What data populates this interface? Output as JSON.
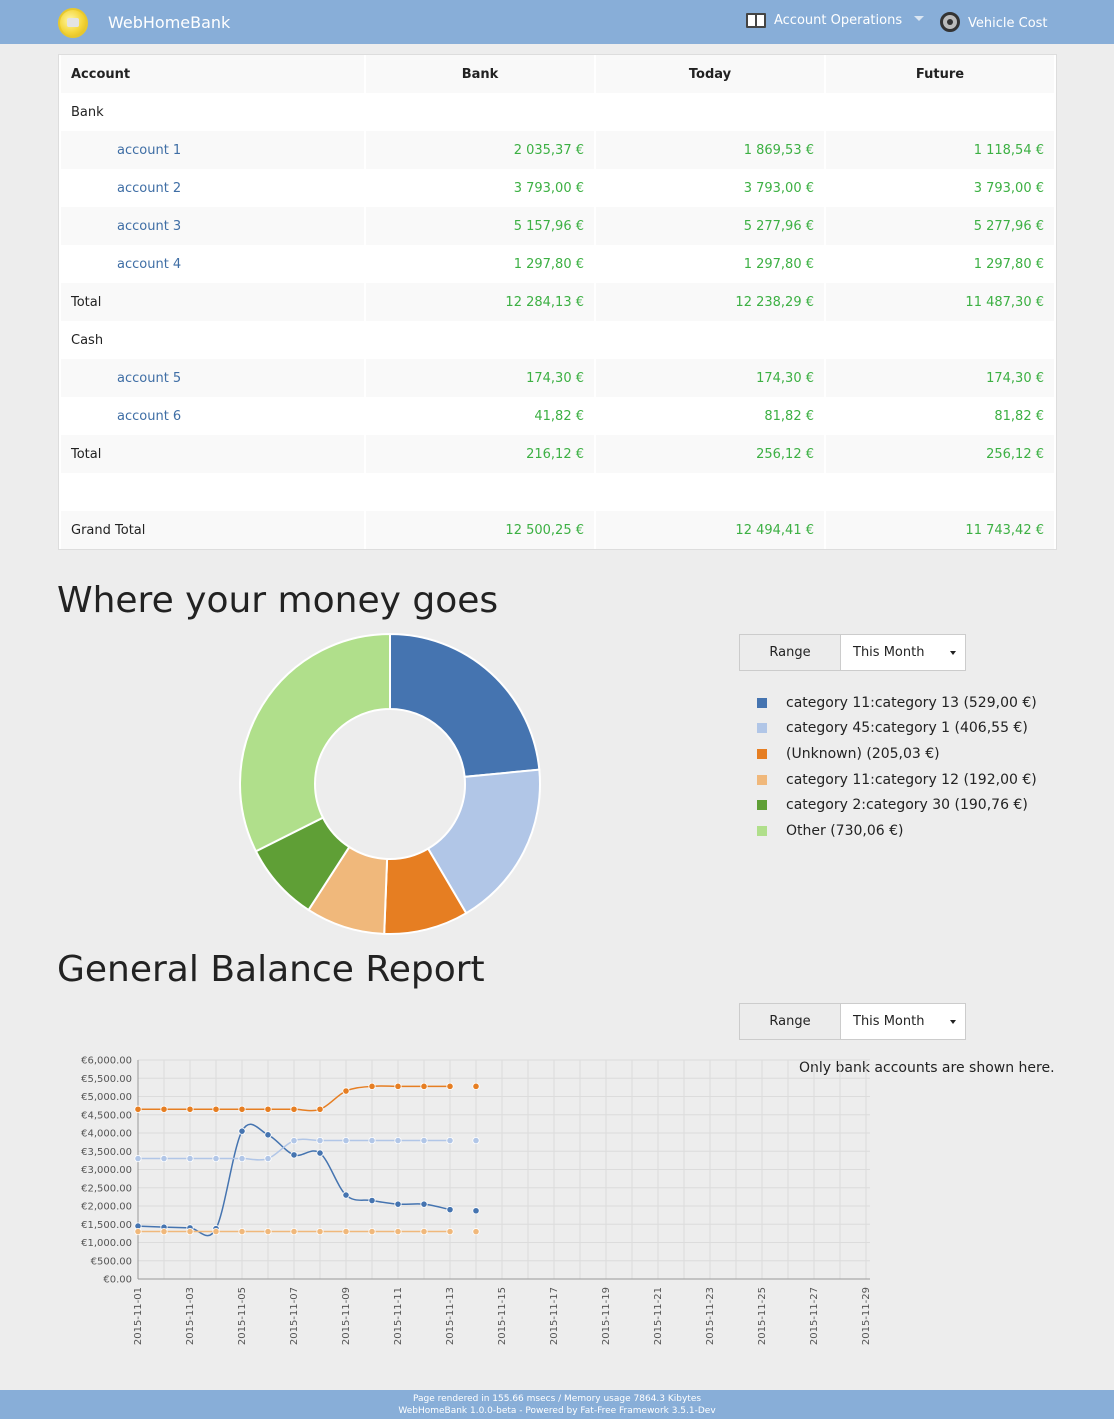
{
  "navbar": {
    "brand": "WebHomeBank",
    "items": [
      {
        "label": "Account Operations",
        "icon": "book-icon"
      },
      {
        "label": "Vehicle Cost",
        "icon": "steering-wheel-icon"
      }
    ]
  },
  "accounts_table": {
    "headers": [
      "Account",
      "Bank",
      "Today",
      "Future"
    ],
    "groups": [
      {
        "name": "Bank",
        "accounts": [
          {
            "name": "account 1",
            "bank": "2 035,37 €",
            "today": "1 869,53 €",
            "future": "1 118,54 €"
          },
          {
            "name": "account 2",
            "bank": "3 793,00 €",
            "today": "3 793,00 €",
            "future": "3 793,00 €"
          },
          {
            "name": "account 3",
            "bank": "5 157,96 €",
            "today": "5 277,96 €",
            "future": "5 277,96 €"
          },
          {
            "name": "account 4",
            "bank": "1 297,80 €",
            "today": "1 297,80 €",
            "future": "1 297,80 €"
          }
        ],
        "total": {
          "label": "Total",
          "bank": "12 284,13 €",
          "today": "12 238,29 €",
          "future": "11 487,30 €"
        }
      },
      {
        "name": "Cash",
        "accounts": [
          {
            "name": "account 5",
            "bank": "174,30 €",
            "today": "174,30 €",
            "future": "174,30 €"
          },
          {
            "name": "account 6",
            "bank": "41,82 €",
            "today": "81,82 €",
            "future": "81,82 €"
          }
        ],
        "total": {
          "label": "Total",
          "bank": "216,12 €",
          "today": "256,12 €",
          "future": "256,12 €"
        }
      }
    ],
    "grand_total": {
      "label": "Grand Total",
      "bank": "12 500,25 €",
      "today": "12 494,41 €",
      "future": "11 743,42 €"
    }
  },
  "money_section": {
    "title": "Where your money goes",
    "range_label": "Range",
    "range_value": "This Month"
  },
  "balance_section": {
    "title": "General Balance Report",
    "range_label": "Range",
    "range_value": "This Month",
    "note": "Only bank accounts are shown here."
  },
  "footer": {
    "line1": "Page rendered in 155.66 msecs / Memory usage 7864.3 Kibytes",
    "line2": "WebHomeBank 1.0.0-beta - Powered by Fat-Free Framework 3.5.1-Dev"
  },
  "chart_data": [
    {
      "type": "pie",
      "donut": true,
      "legend_position": "right",
      "slices": [
        {
          "label": "category 11:category 13 (529,00 €)",
          "value": 529.0,
          "color": "#4574b0"
        },
        {
          "label": "category 45:category 1 (406,55 €)",
          "value": 406.55,
          "color": "#b1c6e7"
        },
        {
          "label": "(Unknown) (205,03 €)",
          "value": 205.03,
          "color": "#e67e22"
        },
        {
          "label": "category 11:category 12 (192,00 €)",
          "value": 192.0,
          "color": "#f0b87b"
        },
        {
          "label": "category 2:category 30 (190,76 €)",
          "value": 190.76,
          "color": "#5f9f36"
        },
        {
          "label": "Other (730,06 €)",
          "value": 730.06,
          "color": "#b0df8b"
        }
      ]
    },
    {
      "type": "line",
      "grid": true,
      "ylim": [
        0,
        6000
      ],
      "y_ticks": [
        "€0.00",
        "€500.00",
        "€1,000.00",
        "€1,500.00",
        "€2,000.00",
        "€2,500.00",
        "€3,000.00",
        "€3,500.00",
        "€4,000.00",
        "€4,500.00",
        "€5,000.00",
        "€5,500.00",
        "€6,000.00"
      ],
      "x_ticks": [
        "2015-11-01",
        "2015-11-03",
        "2015-11-05",
        "2015-11-07",
        "2015-11-09",
        "2015-11-11",
        "2015-11-13",
        "2015-11-15",
        "2015-11-17",
        "2015-11-19",
        "2015-11-21",
        "2015-11-23",
        "2015-11-25",
        "2015-11-27",
        "2015-11-29"
      ],
      "x": [
        "2015-11-01",
        "2015-11-02",
        "2015-11-03",
        "2015-11-04",
        "2015-11-05",
        "2015-11-06",
        "2015-11-07",
        "2015-11-08",
        "2015-11-09",
        "2015-11-10",
        "2015-11-11",
        "2015-11-12",
        "2015-11-13",
        "2015-11-14"
      ],
      "series": [
        {
          "color": "#4574b0",
          "values": [
            1450,
            1420,
            1400,
            1380,
            4050,
            3950,
            3400,
            3450,
            2300,
            2150,
            2050,
            2050,
            1900,
            1869.53
          ]
        },
        {
          "color": "#b1c6e7",
          "values": [
            3300,
            3300,
            3300,
            3300,
            3300,
            3300,
            3790,
            3793,
            3793,
            3793,
            3793,
            3793,
            3793,
            3793
          ]
        },
        {
          "color": "#e67e22",
          "values": [
            4650,
            4650,
            4650,
            4650,
            4650,
            4650,
            4650,
            4650,
            5150,
            5278,
            5278,
            5278,
            5278,
            5277.96
          ]
        },
        {
          "color": "#f0b87b",
          "values": [
            1300,
            1300,
            1300,
            1300,
            1300,
            1300,
            1300,
            1300,
            1300,
            1300,
            1300,
            1300,
            1300,
            1297.8
          ]
        }
      ]
    }
  ]
}
